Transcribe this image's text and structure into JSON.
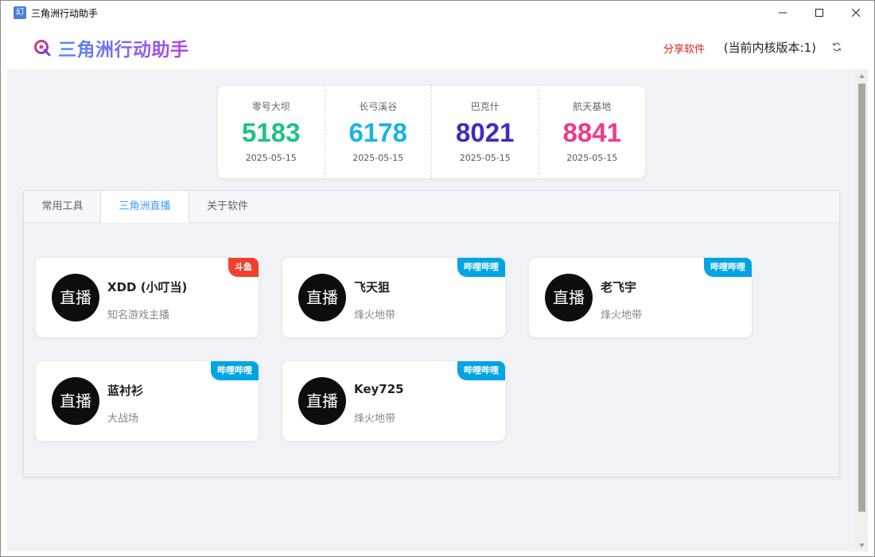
{
  "window": {
    "title": "三角洲行动助手",
    "app_icon_glyph": "幻"
  },
  "header": {
    "logo_text": "三角洲行动助手",
    "share_label": "分享软件",
    "version_label": "(当前内核版本:1)"
  },
  "stats": [
    {
      "label": "零号大坝",
      "value": "5183",
      "date": "2025-05-15",
      "color": "#1ec28b"
    },
    {
      "label": "长弓溪谷",
      "value": "6178",
      "date": "2025-05-15",
      "color": "#1ab3e8"
    },
    {
      "label": "巴克什",
      "value": "8021",
      "date": "2025-05-15",
      "color": "#3f2bc4"
    },
    {
      "label": "航天基地",
      "value": "8841",
      "date": "2025-05-15",
      "color": "#ef3a8a"
    }
  ],
  "tabs": [
    {
      "label": "常用工具",
      "active": false
    },
    {
      "label": "三角洲直播",
      "active": true
    },
    {
      "label": "关于软件",
      "active": false
    }
  ],
  "streamers": [
    {
      "avatar": "直播",
      "name": "XDD (小叮当)",
      "desc": "知名游戏主播",
      "platform": "斗鱼",
      "platform_color": "#f0412f"
    },
    {
      "avatar": "直播",
      "name": "飞天狙",
      "desc": "烽火地带",
      "platform": "哔哩哔哩",
      "platform_color": "#00a4e4"
    },
    {
      "avatar": "直播",
      "name": "老飞宇",
      "desc": "烽火地带",
      "platform": "哔哩哔哩",
      "platform_color": "#00a4e4"
    },
    {
      "avatar": "直播",
      "name": "蓝衬衫",
      "desc": "大战场",
      "platform": "哔哩哔哩",
      "platform_color": "#00a4e4"
    },
    {
      "avatar": "直播",
      "name": "Key725",
      "desc": "烽火地带",
      "platform": "哔哩哔哩",
      "platform_color": "#00a4e4"
    }
  ],
  "icons": {
    "logo": "target-logo-icon",
    "refresh": "refresh-icon",
    "minimize": "minimize-icon",
    "maximize": "maximize-icon",
    "close": "close-icon"
  }
}
